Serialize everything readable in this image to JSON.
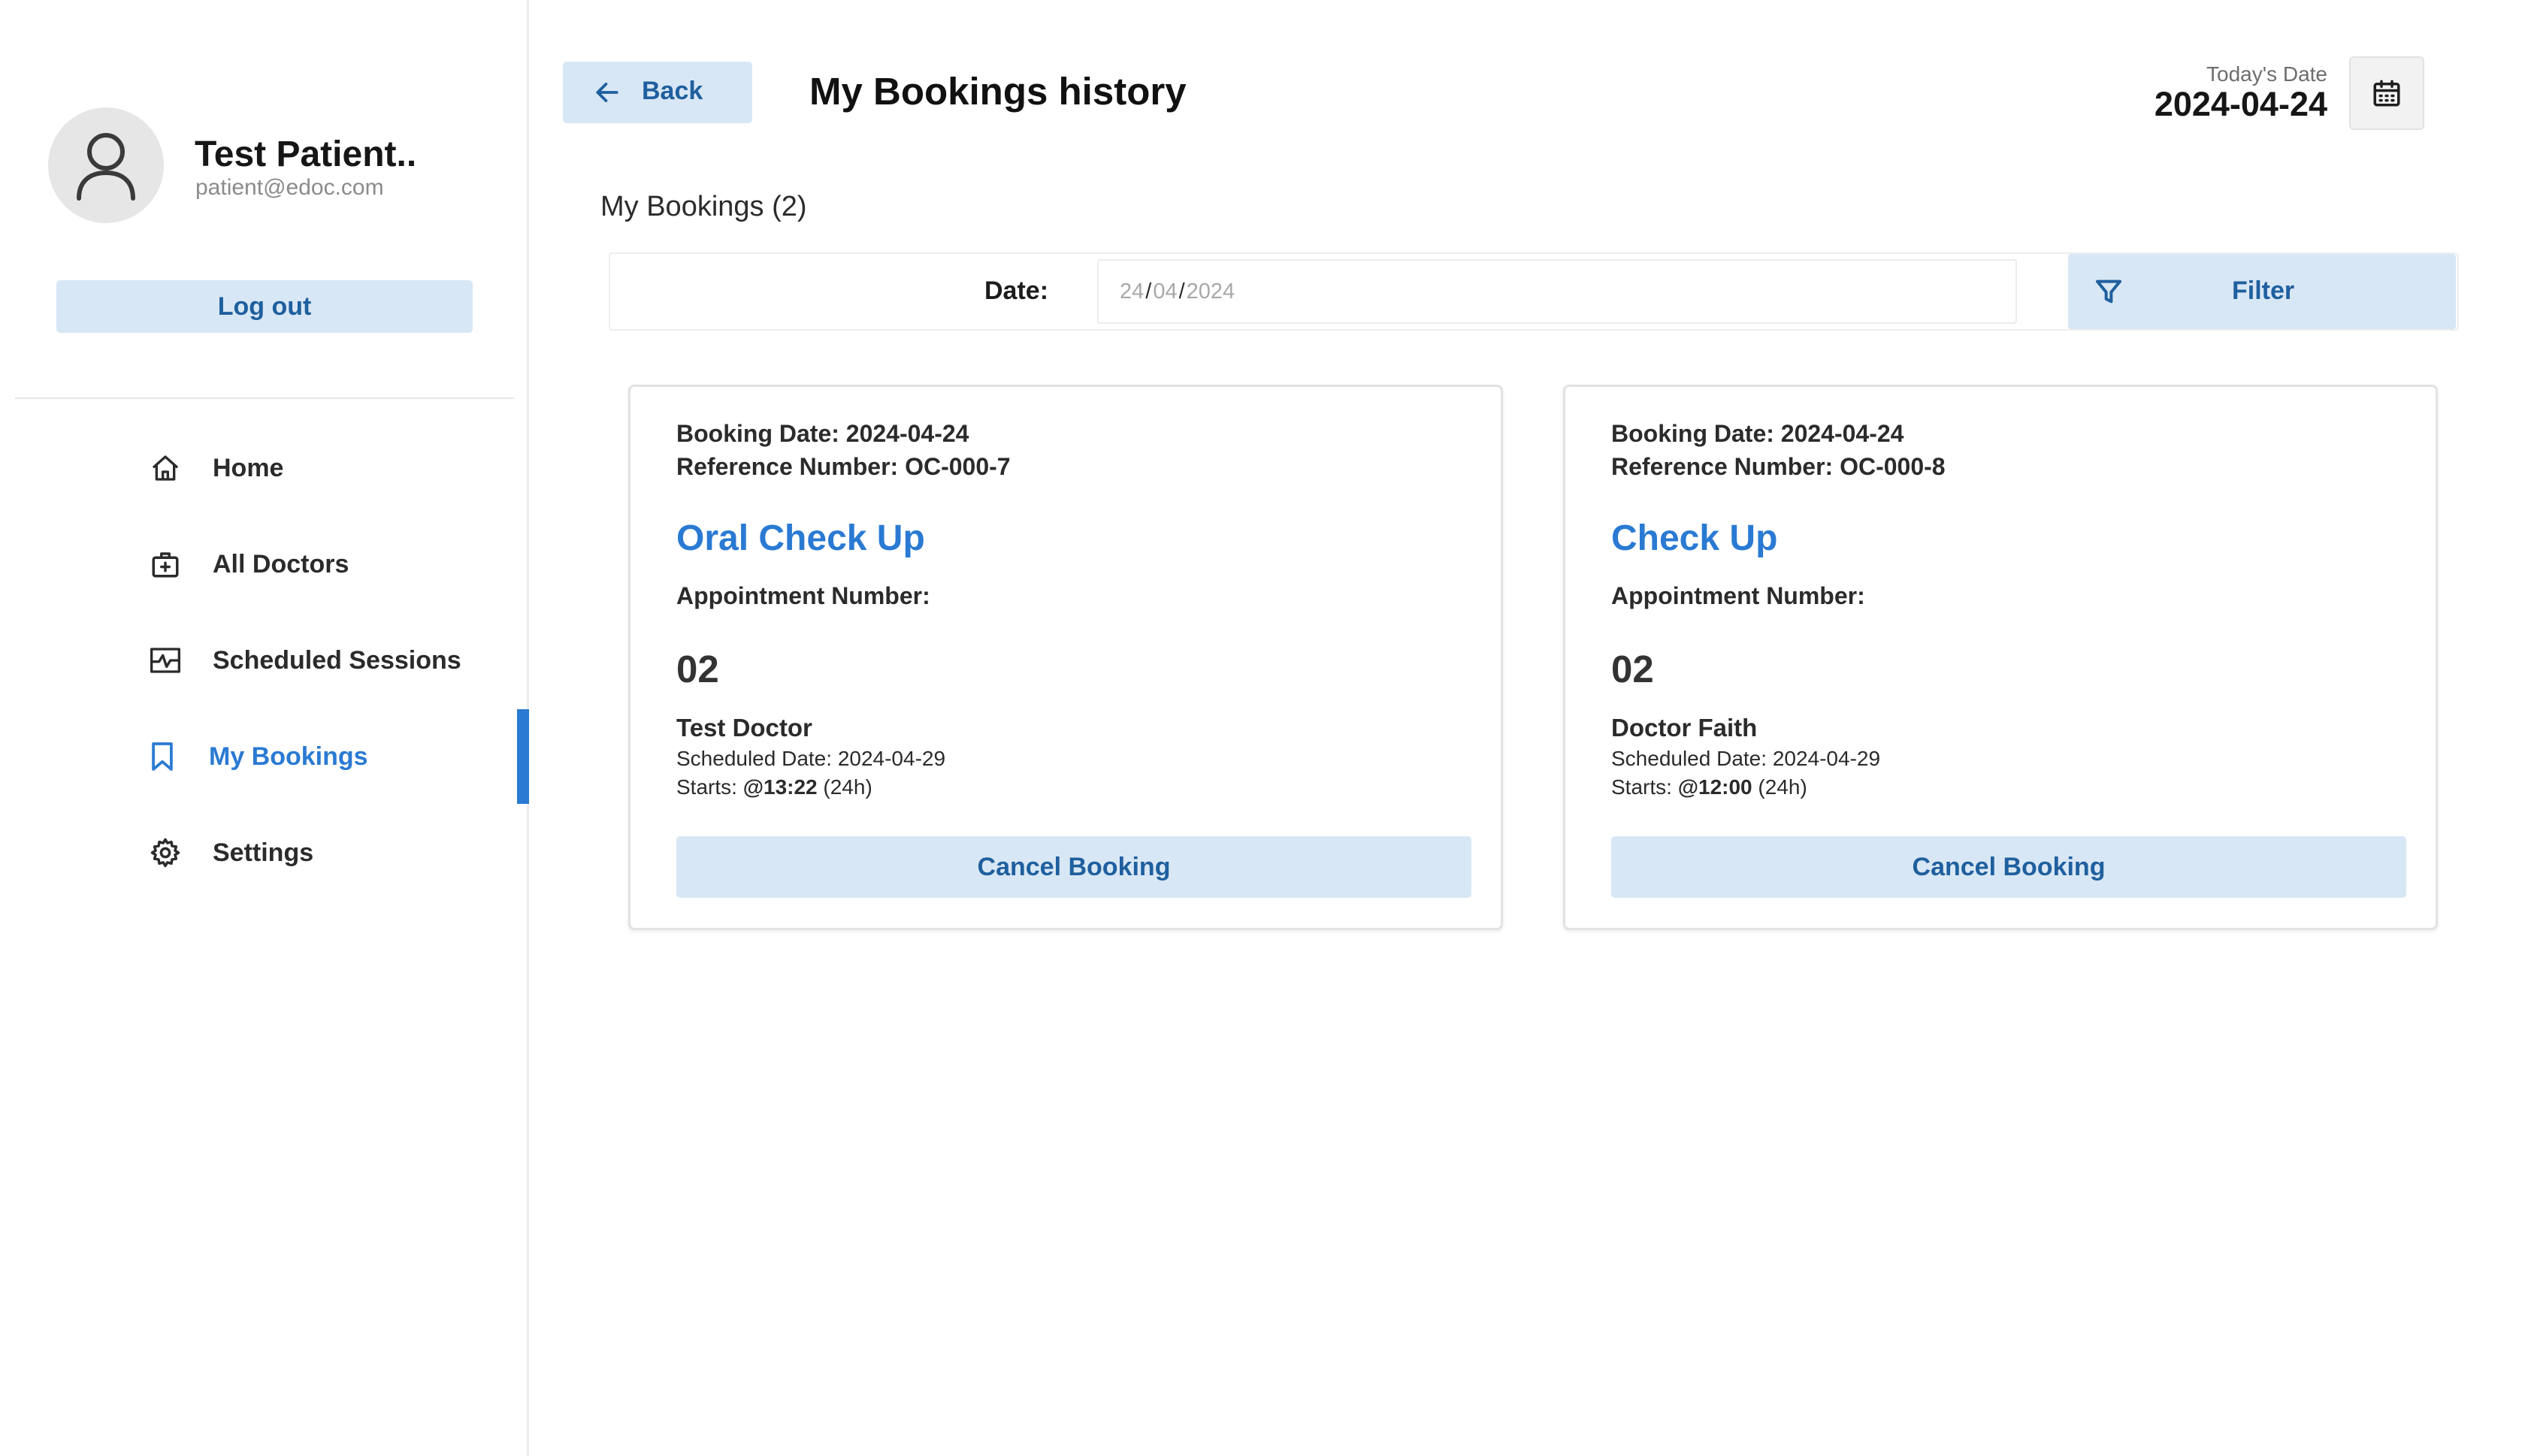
{
  "profile": {
    "name": "Test Patient..",
    "email": "patient@edoc.com",
    "logout_label": "Log out"
  },
  "sidebar": {
    "items": [
      {
        "label": "Home",
        "icon": "home-icon",
        "active": false
      },
      {
        "label": "All Doctors",
        "icon": "doctor-bag-icon",
        "active": false
      },
      {
        "label": "Scheduled Sessions",
        "icon": "schedule-icon",
        "active": false
      },
      {
        "label": "My Bookings",
        "icon": "bookmark-icon",
        "active": true
      },
      {
        "label": "Settings",
        "icon": "gear-icon",
        "active": false
      }
    ]
  },
  "header": {
    "back_label": "Back",
    "title": "My Bookings history",
    "today_label": "Today's Date",
    "today_value": "2024-04-24"
  },
  "bookings": {
    "section_title": "My Bookings (2)",
    "filter": {
      "date_label": "Date:",
      "date_day": "24",
      "date_month": "04",
      "date_year": "2024",
      "date_separator": "/",
      "button_label": "Filter"
    },
    "cards": [
      {
        "booking_date": "Booking Date: 2024-04-24",
        "reference": "Reference Number: OC-000-7",
        "title": "Oral Check Up",
        "appointment_label": "Appointment Number:",
        "appointment_number": "02",
        "doctor": "Test Doctor",
        "scheduled_date": "Scheduled Date: 2024-04-29",
        "starts_prefix": "Starts: ",
        "starts_time": "@13:22",
        "starts_suffix": " (24h)",
        "cancel_label": "Cancel Booking"
      },
      {
        "booking_date": "Booking Date: 2024-04-24",
        "reference": "Reference Number: OC-000-8",
        "title": "Check Up",
        "appointment_label": "Appointment Number:",
        "appointment_number": "02",
        "doctor": "Doctor Faith",
        "scheduled_date": "Scheduled Date: 2024-04-29",
        "starts_prefix": "Starts: ",
        "starts_time": "@12:00",
        "starts_suffix": " (24h)",
        "cancel_label": "Cancel Booking"
      }
    ]
  },
  "colors": {
    "accent": "#2a7ad3",
    "button_bg": "#d8e7f5",
    "button_text": "#1f5f9e"
  }
}
